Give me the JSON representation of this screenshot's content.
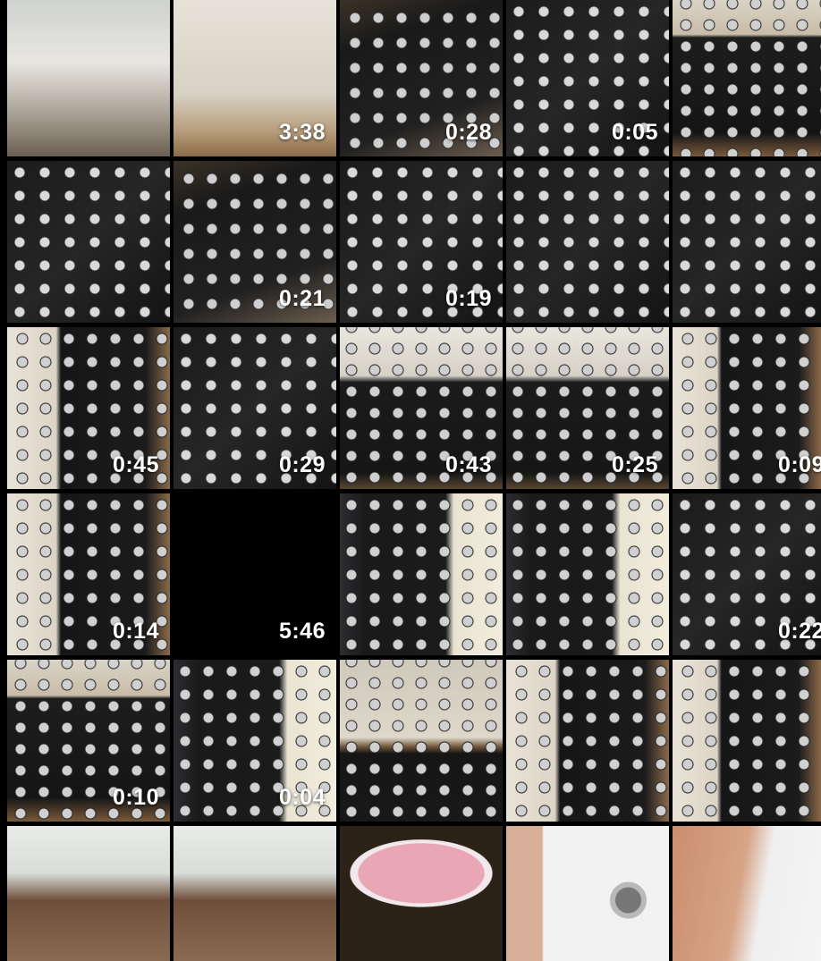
{
  "gallery": {
    "rows": [
      [
        {
          "scene": "room",
          "duration": ""
        },
        {
          "scene": "piano",
          "duration": "3:38"
        },
        {
          "scene": "synth-tilt",
          "duration": "0:28"
        },
        {
          "scene": "synth",
          "duration": "0:05"
        },
        {
          "scene": "synth-wood",
          "duration": ""
        }
      ],
      [
        {
          "scene": "synth",
          "duration": ""
        },
        {
          "scene": "synth-tilt",
          "duration": "0:21"
        },
        {
          "scene": "synth",
          "duration": "0:19"
        },
        {
          "scene": "synth",
          "duration": ""
        },
        {
          "scene": "synth",
          "duration": ""
        }
      ],
      [
        {
          "scene": "synth-hand",
          "duration": "0:45"
        },
        {
          "scene": "synth",
          "duration": "0:29"
        },
        {
          "scene": "synth-desk",
          "duration": "0:43"
        },
        {
          "scene": "synth-desk",
          "duration": "0:25"
        },
        {
          "scene": "synth-hand",
          "duration": "0:09"
        }
      ],
      [
        {
          "scene": "synth-hand",
          "duration": "0:14"
        },
        {
          "scene": "black",
          "duration": "5:46"
        },
        {
          "scene": "synth-notes",
          "duration": ""
        },
        {
          "scene": "synth-notes",
          "duration": ""
        },
        {
          "scene": "synth",
          "duration": "0:22"
        }
      ],
      [
        {
          "scene": "synth-wood",
          "duration": "0:10"
        },
        {
          "scene": "synth-notes",
          "duration": "0:04"
        },
        {
          "scene": "synth-top",
          "duration": ""
        },
        {
          "scene": "synth-hand",
          "duration": ""
        },
        {
          "scene": "synth-hand",
          "duration": ""
        }
      ],
      [
        {
          "scene": "portrait",
          "duration": ""
        },
        {
          "scene": "portrait",
          "duration": ""
        },
        {
          "scene": "projector",
          "duration": ""
        },
        {
          "scene": "sink",
          "duration": ""
        },
        {
          "scene": "arm",
          "duration": ""
        }
      ]
    ]
  }
}
